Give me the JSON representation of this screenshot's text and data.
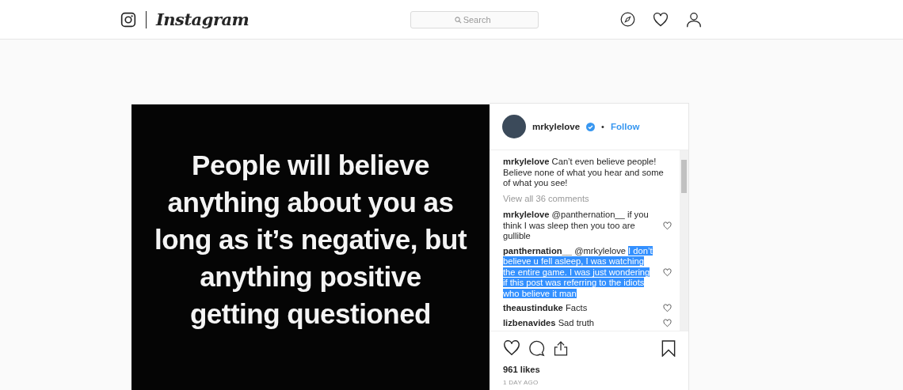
{
  "header": {
    "wordmark": "Instagram",
    "search": {
      "placeholder": "Search"
    }
  },
  "post": {
    "image_lines": [
      "People will believe",
      "anything about you as",
      "long as it’s negative, but",
      "anything positive",
      "getting questioned"
    ],
    "author": {
      "username": "mrkylelove",
      "verified": true,
      "separator": "•",
      "follow": "Follow"
    },
    "caption": {
      "user": "mrkylelove",
      "text": "Can’t even believe people! Believe none of what you hear and some of what you see!"
    },
    "view_all": "View all 36 comments",
    "comments": [
      {
        "user": "mrkylelove",
        "text": "@panthernation__ if you think I was sleep then you too are gullible"
      },
      {
        "user": "panthernation__",
        "text": "@mrkylelove ",
        "highlighted": "I don’t believe u fell asleep, I was watching the entire game. I was just wondering if this post was referring to the idiots who believe it man"
      },
      {
        "user": "theaustinduke",
        "text": "Facts"
      },
      {
        "user": "lizbenavides",
        "text": "Sad truth"
      }
    ],
    "likes": "961 likes",
    "time": "1 DAY AGO"
  }
}
